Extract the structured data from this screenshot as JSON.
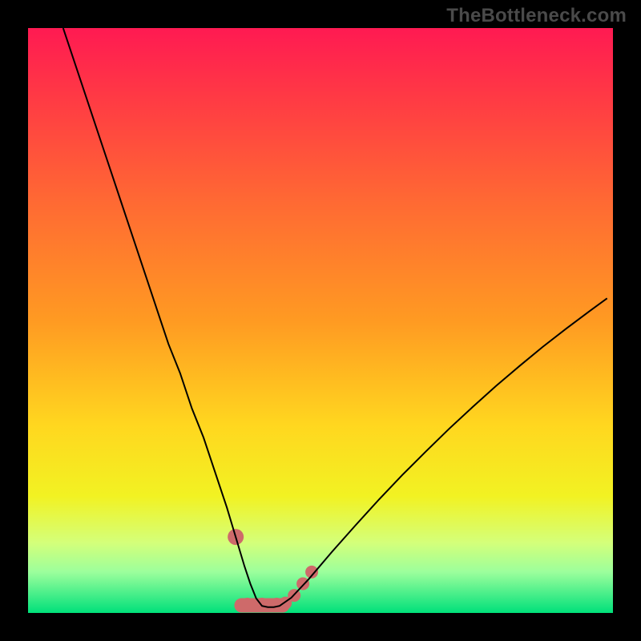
{
  "watermark": "TheBottleneck.com",
  "chart_data": {
    "type": "line",
    "title": "",
    "xlabel": "",
    "ylabel": "",
    "xlim": [
      0,
      100
    ],
    "ylim": [
      0,
      100
    ],
    "grid": false,
    "legend": false,
    "gradient_background": {
      "stops": [
        {
          "offset": 0.0,
          "color": "#ff1a52"
        },
        {
          "offset": 0.12,
          "color": "#ff3a44"
        },
        {
          "offset": 0.3,
          "color": "#ff6a33"
        },
        {
          "offset": 0.5,
          "color": "#ff9a22"
        },
        {
          "offset": 0.68,
          "color": "#ffd71f"
        },
        {
          "offset": 0.8,
          "color": "#f2f222"
        },
        {
          "offset": 0.88,
          "color": "#d4ff7a"
        },
        {
          "offset": 0.93,
          "color": "#9cff9c"
        },
        {
          "offset": 1.0,
          "color": "#00e07a"
        }
      ]
    },
    "series": [
      {
        "name": "bottleneck-curve",
        "color": "#000000",
        "x": [
          6,
          8,
          10,
          12,
          14,
          16,
          18,
          20,
          22,
          24,
          26,
          28,
          30,
          32,
          34,
          35.5,
          37,
          38,
          39,
          40,
          41,
          42,
          43,
          45,
          48,
          52,
          56,
          60,
          64,
          68,
          72,
          76,
          80,
          84,
          88,
          92,
          96,
          99
        ],
        "y": [
          100,
          94,
          88,
          82,
          76,
          70,
          64,
          58,
          52,
          46,
          41,
          35,
          30,
          24,
          18,
          13,
          8,
          5,
          2.5,
          1.2,
          1.0,
          1.0,
          1.2,
          2.6,
          5.8,
          10.5,
          15.0,
          19.4,
          23.6,
          27.6,
          31.5,
          35.2,
          38.8,
          42.2,
          45.5,
          48.6,
          51.6,
          53.8
        ]
      }
    ],
    "bottom_markers": {
      "color": "#ce6a6a",
      "radius_main": 10,
      "radius_series": 8,
      "points": [
        {
          "x": 35.5,
          "y": 13
        },
        {
          "x": 37.5,
          "y": 1.5
        },
        {
          "x": 40.0,
          "y": 1.5
        },
        {
          "x": 42.5,
          "y": 1.5
        },
        {
          "x": 44.0,
          "y": 1.7
        },
        {
          "x": 45.5,
          "y": 3.0
        },
        {
          "x": 47.0,
          "y": 5.0
        },
        {
          "x": 48.5,
          "y": 7.0
        }
      ],
      "bar": {
        "x_from": 36.5,
        "x_to": 43.5,
        "y": 1.3,
        "thickness": 18
      }
    }
  }
}
